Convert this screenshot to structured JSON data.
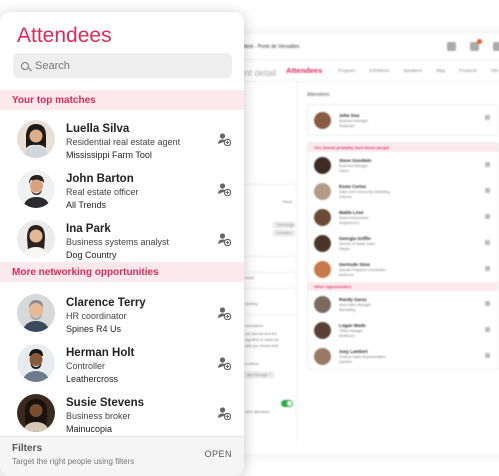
{
  "panel": {
    "title": "Attendees",
    "search_placeholder": "Search",
    "sections": [
      {
        "label": "Your top matches",
        "people": [
          {
            "name": "Luella Silva",
            "title": "Residential real estate agent",
            "company": "Mississippi Farm Tool"
          },
          {
            "name": "John Barton",
            "title": "Real estate officer",
            "company": "All Trends"
          },
          {
            "name": "Ina Park",
            "title": "Business systems analyst",
            "company": "Dog Country"
          }
        ]
      },
      {
        "label": "More networking opportunities",
        "people": [
          {
            "name": "Clarence Terry",
            "title": "HR coordinator",
            "company": "Spines R4 Us"
          },
          {
            "name": "Herman Holt",
            "title": "Controller",
            "company": "Leathercross"
          },
          {
            "name": "Susie Stevens",
            "title": "Business broker",
            "company": "Mainucopia"
          }
        ]
      }
    ],
    "filters": {
      "title": "Filters",
      "subtitle": "Target the right people using filters",
      "action": "OPEN"
    }
  },
  "background": {
    "window_title": "Next - Porte de Versailles",
    "heading_fragment": "vent detail",
    "tabs": [
      "Attendees",
      "Program",
      "Exhibitors",
      "Speakers",
      "Map",
      "Products",
      "Oth"
    ],
    "left_fragments": {
      "f1": "Reset",
      "chip1": "Technology",
      "chip2": "Innovation",
      "f2": "ences",
      "f3": "meeting",
      "f4": "mendations",
      "f5": "ons that will feed the",
      "f6": "algorithm to refine the",
      "f7": "ople you should meet",
      "f8": "n criteria",
      "chip3": "ales Manager ×",
      "f9": "other attendees"
    },
    "main_title": "Attendees",
    "featured": {
      "name": "John Doe",
      "title": "Business Manager",
      "company": "Swapcard"
    },
    "band1": "You should probably meet these people",
    "suggested": [
      {
        "name": "Steve Goodwin",
        "title": "Business Manager",
        "company": "Kanes"
      },
      {
        "name": "Essie Cortez",
        "title": "Sales and Community Marketing",
        "company": "Zoteone"
      },
      {
        "name": "Mable Love",
        "title": "Brand Ambassador",
        "company": "Singletechno"
      },
      {
        "name": "Georgia Griffin",
        "title": "Director of Inside Sales",
        "company": "Staplor"
      },
      {
        "name": "Gertrude Sims",
        "title": "Special Programs Coordinator",
        "company": "Bertiscofi"
      }
    ],
    "band2": "Other opportunities",
    "others": [
      {
        "name": "Randy Garza",
        "title": "Area Sales Manager",
        "company": "Bizholding"
      },
      {
        "name": "Logan Wade",
        "title": "Office Manager",
        "company": "Multitouch"
      },
      {
        "name": "Amy Lambert",
        "title": "Territory Sales Representative",
        "company": "Spinfind"
      }
    ]
  },
  "colors": {
    "accent": "#d92b5a",
    "section_bg": "#fbe9ee",
    "toggle": "#2ea84a",
    "notification_dot": "#f05a28"
  },
  "icons": {
    "add_contact": "add-contact-icon",
    "search": "search-icon"
  }
}
